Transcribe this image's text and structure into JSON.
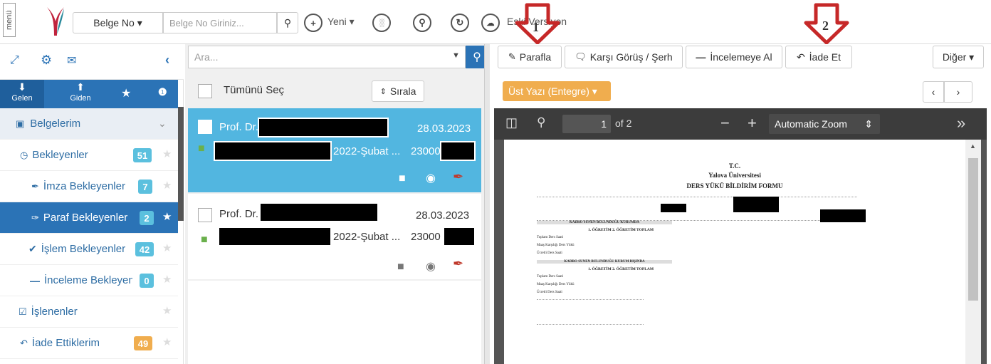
{
  "topbar": {
    "menu_label": "menü",
    "belge_no_label": "Belge No ▾",
    "search_placeholder": "Belge No Giriniz...",
    "yeni_label": "Yeni ▾",
    "eski_versiyon_label": "Eski Versiyon"
  },
  "sidebar": {
    "tabs": [
      "Gelen",
      "Giden"
    ],
    "section_title": "Belgelerim",
    "items": [
      {
        "label": "Bekleyenler",
        "count": "51",
        "badge_color": "#5bc0de"
      },
      {
        "label": "İmza Bekleyenler",
        "count": "7",
        "badge_color": "#5bc0de"
      },
      {
        "label": "Paraf Bekleyenler",
        "count": "2",
        "badge_color": "#5bc0de"
      },
      {
        "label": "İşlem Bekleyenler",
        "count": "42",
        "badge_color": "#5bc0de"
      },
      {
        "label": "İnceleme Bekleyenler",
        "count": "0",
        "badge_color": "#5bc0de"
      },
      {
        "label": "İşlenenler",
        "count": "",
        "badge_color": ""
      },
      {
        "label": "İade Ettiklerim",
        "count": "49",
        "badge_color": "#f0ad4e"
      }
    ]
  },
  "list": {
    "search_placeholder": "Ara...",
    "select_all_label": "Tümünü Seç",
    "sort_label": "Sırala",
    "rows": [
      {
        "title": "Prof. Dr.",
        "date": "28.03.2023",
        "subject": "2022-Şubat ...",
        "number": "23000"
      },
      {
        "title": "Prof. Dr.",
        "date": "28.03.2023",
        "subject": "2022-Şubat ...",
        "number": "23000"
      }
    ]
  },
  "toolbar": {
    "parafla_label": "Parafla",
    "karsi_gorus_label": "Karşı Görüş / Şerh",
    "inceleme_label": "İncelemeye Al",
    "iade_label": "İade Et",
    "diger_label": "Diğer ▾",
    "annotation_1": "1",
    "annotation_2": "2",
    "ust_yazi_label": "Üst Yazı (Entegre) ▾"
  },
  "pdf": {
    "page_current": "1",
    "page_total": "of 2",
    "zoom_label": "Automatic Zoom",
    "doc_header1": "T.C.",
    "doc_header2": "Yalova Üniversitesi",
    "doc_title": "DERS YÜKÜ BİLDİRİM FORMU",
    "kadro_1": "KADRO SUNEN BULUNDUĞU KURUMDA",
    "kadro_2": "KADRO SUNEN BULUNDUĞU KURUM DIŞINDA",
    "ogretim_header": "1. ÖĞRETİM 2. ÖĞRETİM TOPLAM",
    "rows": [
      "Toplam Ders Saati",
      "Maaş Karşılığı Ders Yükü",
      "Ücretli Ders Saati"
    ]
  },
  "colors": {
    "accent": "#2b73b6",
    "info": "#5bc0de",
    "warning": "#f0ad4e",
    "selected_row": "#52b6e0",
    "viewer_bar": "#3c3c3c"
  }
}
